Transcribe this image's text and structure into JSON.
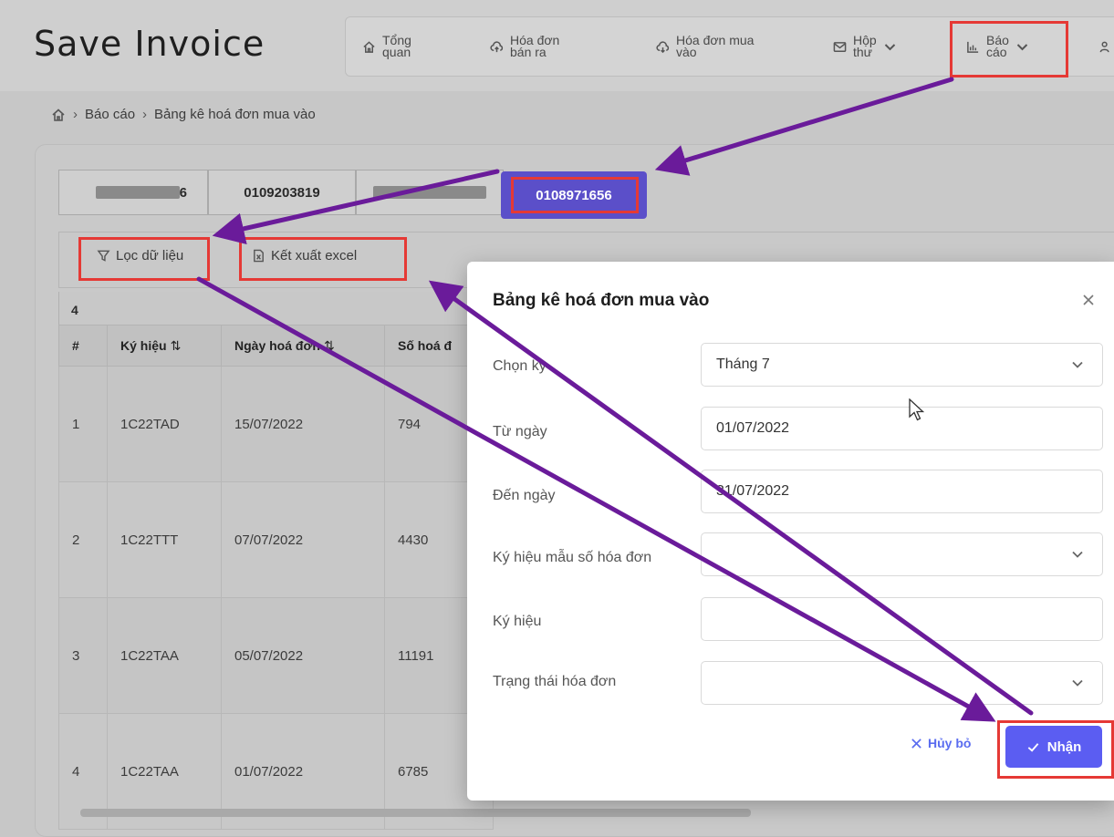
{
  "app": {
    "logo": "Save Invoice"
  },
  "nav": [
    {
      "label": "Tổng\nquan",
      "icon": "home-icon"
    },
    {
      "label": "Hóa đơn\nbán ra",
      "icon": "cloud-upload-icon"
    },
    {
      "label": "Hóa đơn mua\nvào",
      "icon": "cloud-download-icon"
    },
    {
      "label": "Hộp\nthư",
      "icon": "mail-icon"
    },
    {
      "label": "Báo\ncáo",
      "icon": "bar-chart-icon"
    }
  ],
  "breadcrumb": {
    "level1": "Báo cáo",
    "level2": "Bảng kê hoá đơn mua vào"
  },
  "tabs": [
    {
      "label": "6",
      "masked": true
    },
    {
      "label": "0109203819"
    },
    {
      "label": "",
      "masked": true
    },
    {
      "label": "0108971656",
      "active": true
    }
  ],
  "toolbar": {
    "filter": "Lọc dữ liệu",
    "export": "Kết xuất excel"
  },
  "table": {
    "count": "4",
    "headers": [
      "#",
      "Ký hiệu",
      "Ngày hoá đơn",
      "Số hoá đ"
    ],
    "rows": [
      [
        "1",
        "1C22TAD",
        "15/07/2022",
        "794"
      ],
      [
        "2",
        "1C22TTT",
        "07/07/2022",
        "4430"
      ],
      [
        "3",
        "1C22TAA",
        "05/07/2022",
        "11191"
      ],
      [
        "4",
        "1C22TAA",
        "01/07/2022",
        "6785"
      ]
    ]
  },
  "modal": {
    "title": "Bảng kê hoá đơn mua vào",
    "fields": [
      {
        "label": "Chọn kỳ",
        "value": "Tháng 7",
        "dropdown": true
      },
      {
        "label": "Từ ngày",
        "value": "01/07/2022"
      },
      {
        "label": "Đến ngày",
        "value": "31/07/2022"
      },
      {
        "label": "Ký hiệu mẫu số hóa đơn",
        "value": "",
        "dropdown": true
      },
      {
        "label": "Ký hiệu",
        "value": ""
      },
      {
        "label": "Trạng thái hóa đơn",
        "value": "",
        "dropdown": true
      }
    ],
    "cancel": "Hủy bỏ",
    "ok": "Nhận"
  },
  "colors": {
    "primary": "#5b5df2",
    "highlight": "#e53935",
    "arrow": "#6a1b9a",
    "active_tab": "#5b4fc9"
  }
}
